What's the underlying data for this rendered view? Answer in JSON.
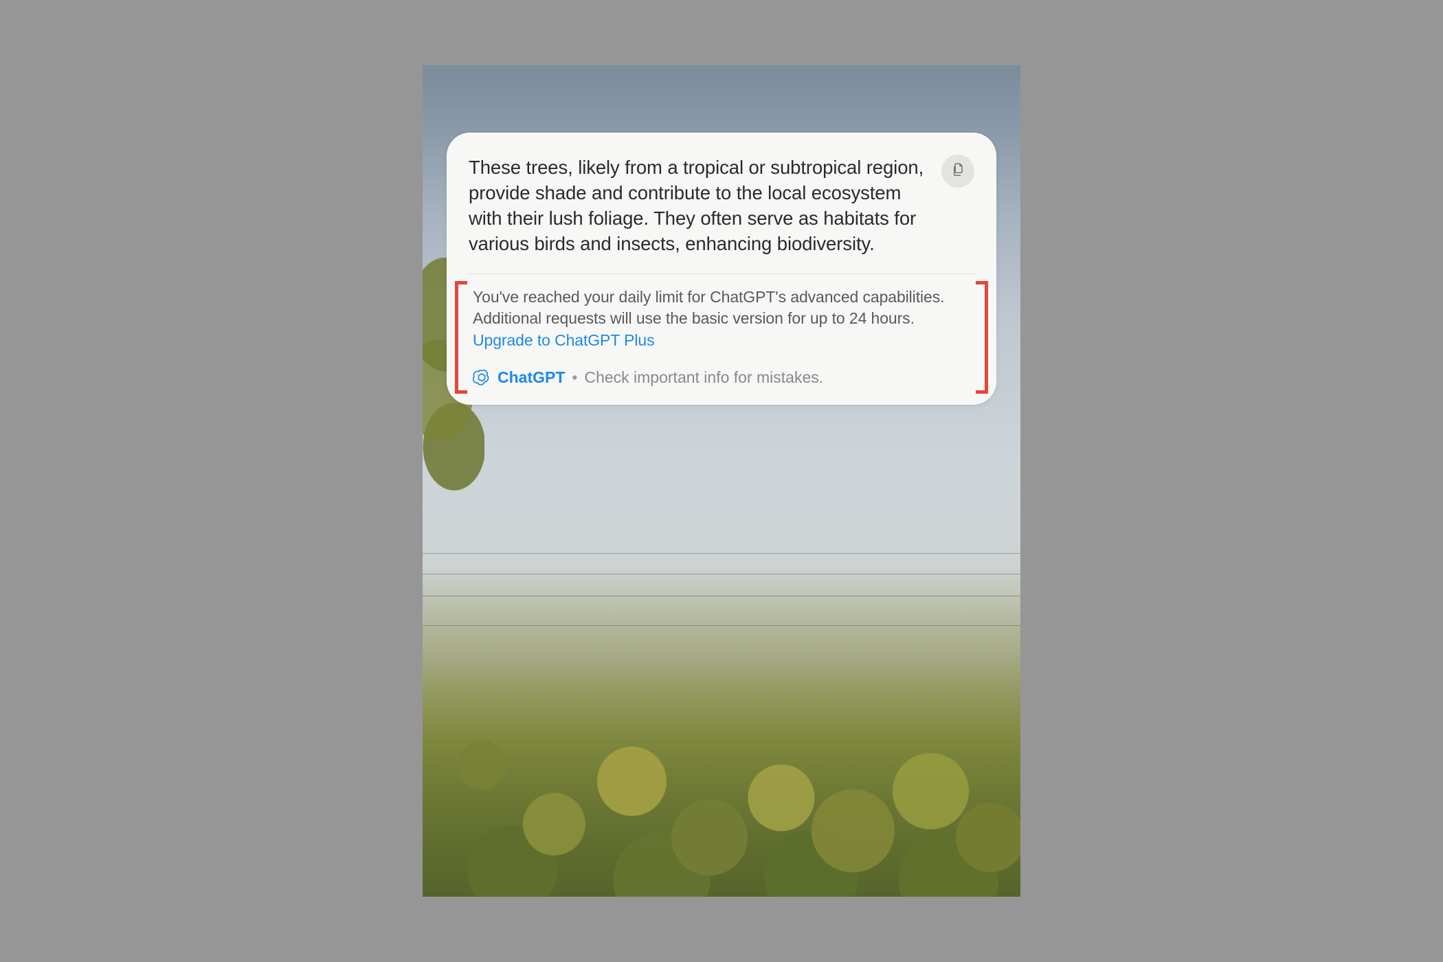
{
  "response": {
    "body": "These trees, likely from a tropical or subtropical region, provide shade and contribute to the local ecosystem with their lush foliage. They often serve as habitats for various birds and insects, enhancing biodiversity."
  },
  "notice": {
    "message": "You've reached your daily limit for ChatGPT's advanced capabilities. Additional requests will use the basic version for up to 24 hours. ",
    "upgrade_link": "Upgrade to ChatGPT Plus"
  },
  "footer": {
    "brand": "ChatGPT",
    "separator": "•",
    "disclaimer": "Check important info for mistakes."
  },
  "icons": {
    "copy": "copy-icon",
    "brand": "openai-logo-icon"
  },
  "colors": {
    "highlight_bracket": "#e8453a",
    "link": "#1e88e8",
    "card_bg": "#f7f8f6"
  }
}
